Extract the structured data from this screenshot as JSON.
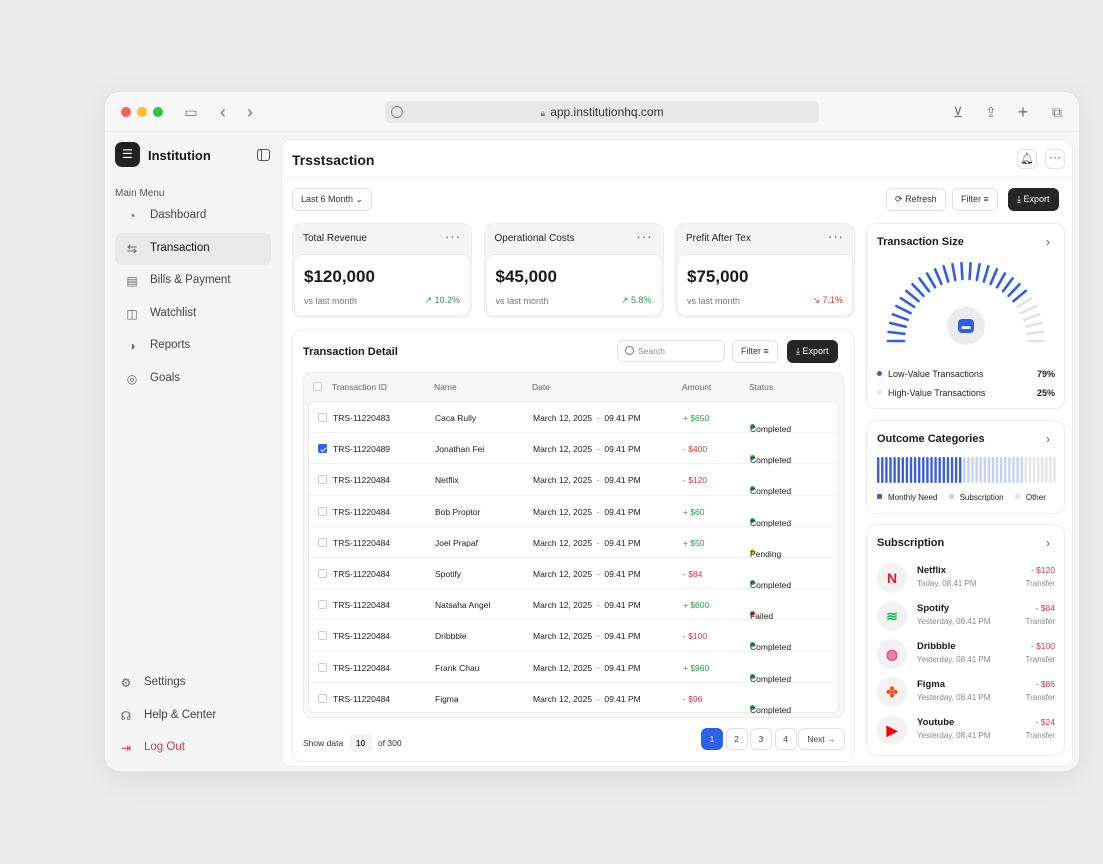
{
  "browser": {
    "url": "app.institutionhq.com",
    "colors": {
      "close": "#ff5f57",
      "min": "#febc2e",
      "max": "#28c840"
    }
  },
  "sidebar": {
    "brand": "Institution",
    "menu_heading": "Main Menu",
    "items": [
      {
        "label": "Dashboard",
        "icon": "dashboard-icon",
        "glyph": "◔"
      },
      {
        "label": "Transaction",
        "icon": "transfer-arrows-icon",
        "glyph": "⇆"
      },
      {
        "label": "Bills & Payment",
        "icon": "bills-icon",
        "glyph": "▤"
      },
      {
        "label": "Watchlist",
        "icon": "watchlist-icon",
        "glyph": "◫"
      },
      {
        "label": "Reports",
        "icon": "reports-icon",
        "glyph": "◑"
      },
      {
        "label": "Goals",
        "icon": "goals-icon",
        "glyph": "◎"
      }
    ],
    "bottom": [
      {
        "label": "Settings",
        "icon": "gear-icon",
        "glyph": "⚙"
      },
      {
        "label": "Help & Center",
        "icon": "headset-icon",
        "glyph": "☊"
      },
      {
        "label": "Log Out",
        "icon": "logout-icon",
        "glyph": "⇥"
      }
    ]
  },
  "header": {
    "title": "Trsstsaction"
  },
  "toolbar": {
    "period": "Last 6 Month",
    "refresh": "Refresh",
    "filter": "Filter",
    "export": "Export"
  },
  "stats": [
    {
      "title": "Total Revenue",
      "value": "$120,000",
      "sub": "vs last month",
      "change": "↗ 10.2%",
      "trend": "up"
    },
    {
      "title": "Operational Costs",
      "value": "$45,000",
      "sub": "vs last month",
      "change": "↗ 5.8%",
      "trend": "up"
    },
    {
      "title": "Prefit After Tex",
      "value": "$75,000",
      "sub": "vs last month",
      "change": "↘ 7.1%",
      "trend": "down"
    }
  ],
  "transactions": {
    "title": "Transaction Detail",
    "search_placeholder": "Search",
    "filter": "Filter",
    "export": "Export",
    "columns": [
      "Transaction ID",
      "Name",
      "Date",
      "Amount",
      "Status"
    ],
    "rows": [
      {
        "id": "TRS-11220483",
        "name": "Caca Rully",
        "date": "March 12, 2025  ·  09.41 PM",
        "amount": "+ $650",
        "status": "Completed",
        "checked": false
      },
      {
        "id": "TRS-11220489",
        "name": "Jonathan Fei",
        "date": "March 12, 2025  ·  09.41 PM",
        "amount": "- $400",
        "status": "Completed",
        "checked": true
      },
      {
        "id": "TRS-11220484",
        "name": "Netflix",
        "date": "March 12, 2025  ·  09.41 PM",
        "amount": "- $120",
        "status": "Completed",
        "checked": false
      },
      {
        "id": "TRS-11220484",
        "name": "Bob Proptor",
        "date": "March 12, 2025  ·  09.41 PM",
        "amount": "+ $60",
        "status": "Completed",
        "checked": false
      },
      {
        "id": "TRS-11220484",
        "name": "Joel Prapaf",
        "date": "March 12, 2025  ·  09.41 PM",
        "amount": "+ $50",
        "status": "Pending",
        "checked": false
      },
      {
        "id": "TRS-11220484",
        "name": "Spotify",
        "date": "March 12, 2025  ·  09.41 PM",
        "amount": "- $84",
        "status": "Completed",
        "checked": false
      },
      {
        "id": "TRS-11220484",
        "name": "Natsaha Angel",
        "date": "March 12, 2025  ·  09.41 PM",
        "amount": "+ $600",
        "status": "Failed",
        "checked": false
      },
      {
        "id": "TRS-11220484",
        "name": "Dribbble",
        "date": "March 12, 2025  ·  09.41 PM",
        "amount": "- $100",
        "status": "Completed",
        "checked": false
      },
      {
        "id": "TRS-11220484",
        "name": "Frank Chau",
        "date": "March 12, 2025  ·  09.41 PM",
        "amount": "+ $960",
        "status": "Completed",
        "checked": false
      },
      {
        "id": "TRS-11220484",
        "name": "Figma",
        "date": "March 12, 2025  ·  09.41 PM",
        "amount": "- $96",
        "status": "Completed",
        "checked": false
      }
    ],
    "footer": {
      "show_label": "Show data",
      "per_page": "10",
      "of_label": "of 300"
    },
    "pages": [
      "1",
      "2",
      "3",
      "4"
    ],
    "next": "Next"
  },
  "size": {
    "title": "Transaction Size",
    "low_label": "Low-Value Transactions",
    "low_pct": "79%",
    "high_label": "High-Value Transactions",
    "high_pct": "25%",
    "colors": {
      "low": "#2f5fe8",
      "high": "#e2e2e2"
    }
  },
  "outcome": {
    "title": "Outcome Categories",
    "legend": [
      {
        "label": "Monthly Need",
        "color": "#3a5fd8"
      },
      {
        "label": "Subscription",
        "color": "#c5d1f2"
      },
      {
        "label": "Other",
        "color": "#e4e4e4"
      }
    ]
  },
  "subscription": {
    "title": "Subscription",
    "items": [
      {
        "name": "Netflix",
        "time": "Today, 08.41 PM",
        "amount": "- $120",
        "type": "Transfer",
        "glyph": "N",
        "color": "#d81f26",
        "icon": "netflix-logo-icon"
      },
      {
        "name": "Spotify",
        "time": "Yesterday, 08.41 PM",
        "amount": "- $84",
        "type": "Transfer",
        "glyph": "≋",
        "color": "#1db954",
        "icon": "spotify-logo-icon"
      },
      {
        "name": "Dribbble",
        "time": "Yesterday, 08.41 PM",
        "amount": "- $100",
        "type": "Transfer",
        "glyph": "◍",
        "color": "#ea4c89",
        "icon": "dribbble-logo-icon"
      },
      {
        "name": "Figma",
        "time": "Yesterday, 08.41 PM",
        "amount": "- $86",
        "type": "Transfer",
        "glyph": "✤",
        "color": "#f24e1e",
        "icon": "figma-logo-icon"
      },
      {
        "name": "Youtube",
        "time": "Yesterday, 08.41 PM",
        "amount": "- $24",
        "type": "Transfer",
        "glyph": "▶",
        "color": "#ff0000",
        "icon": "youtube-logo-icon"
      }
    ]
  }
}
